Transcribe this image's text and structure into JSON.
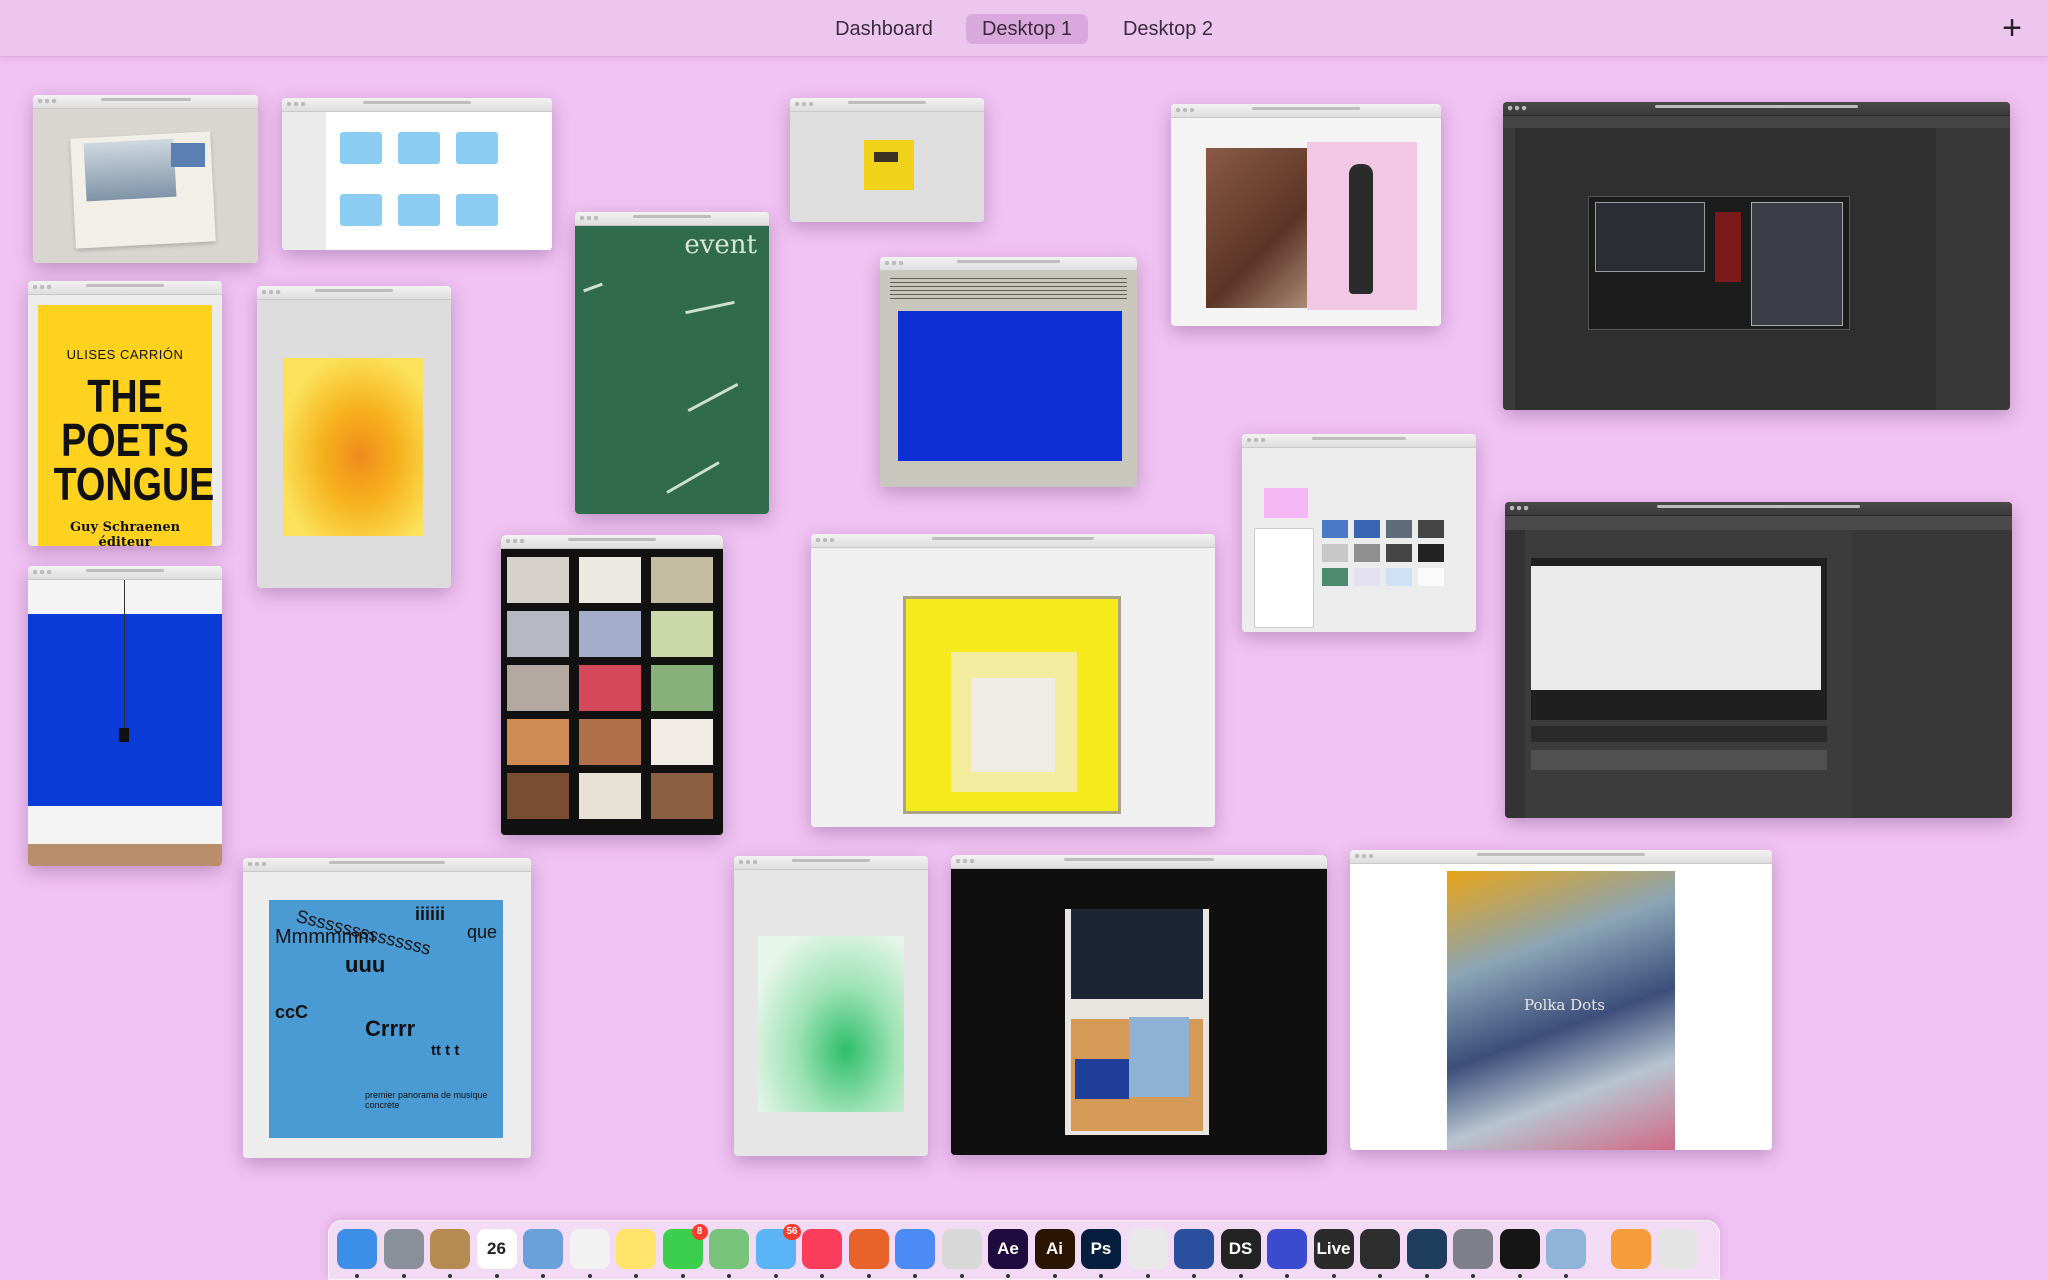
{
  "spaces": {
    "tabs": [
      {
        "label": "Dashboard",
        "active": false
      },
      {
        "label": "Desktop 1",
        "active": true
      },
      {
        "label": "Desktop 2",
        "active": false
      }
    ],
    "add_label": "+"
  },
  "windows": {
    "poets_tongue": {
      "author": "ULISES CARRIÓN",
      "title_line1": "THE",
      "title_line2": "POETS",
      "title_line3": "TONGUE",
      "publisher_line1": "Guy Schraenen",
      "publisher_line2": "éditeur"
    },
    "chalkboard": {
      "word": "event"
    },
    "concrete_music": {
      "line1": "Sssssssssssssss",
      "line2": "Mmmmmm",
      "line3": "uuu",
      "line4": "ccC",
      "line5": "Crrrr",
      "line6": "tt t t",
      "line7": "iiiiii",
      "line8": "que",
      "caption": "premier panorama de musique concrète"
    },
    "bags": {
      "caption": "Polka Dots"
    }
  },
  "dock": {
    "apps": [
      {
        "name": "finder-icon",
        "label": "",
        "color": "#3c8ee6"
      },
      {
        "name": "launchpad-icon",
        "label": "",
        "color": "#8a9099"
      },
      {
        "name": "contacts-icon",
        "label": "",
        "color": "#b78a52"
      },
      {
        "name": "calendar-icon",
        "label": "26",
        "color": "#ffffff"
      },
      {
        "name": "preview-icon",
        "label": "",
        "color": "#6aa0d8"
      },
      {
        "name": "photos-icon",
        "label": "",
        "color": "#f2f2f2"
      },
      {
        "name": "notes-icon",
        "label": "",
        "color": "#ffe36b"
      },
      {
        "name": "facetime-icon",
        "label": "",
        "color": "#3ccf4e",
        "badge": "8"
      },
      {
        "name": "maps-icon",
        "label": "",
        "color": "#79c27a"
      },
      {
        "name": "messages-icon",
        "label": "",
        "color": "#5ab4f5",
        "badge": "56"
      },
      {
        "name": "music-icon",
        "label": "",
        "color": "#fb3d5c"
      },
      {
        "name": "firefox-icon",
        "label": "",
        "color": "#e8632b"
      },
      {
        "name": "chrome-icon",
        "label": "",
        "color": "#4c8bf5"
      },
      {
        "name": "zbrush-icon",
        "label": "",
        "color": "#d8d8d8"
      },
      {
        "name": "after-effects-icon",
        "label": "Ae",
        "color": "#1f0b40"
      },
      {
        "name": "illustrator-icon",
        "label": "Ai",
        "color": "#2b1400"
      },
      {
        "name": "photoshop-icon",
        "label": "Ps",
        "color": "#061e3e"
      },
      {
        "name": "scrivener-icon",
        "label": "",
        "color": "#e9e9e9"
      },
      {
        "name": "cinema4d-icon",
        "label": "",
        "color": "#2a4f9e"
      },
      {
        "name": "dazstudio-icon",
        "label": "DS",
        "color": "#232323"
      },
      {
        "name": "coda-icon",
        "label": "",
        "color": "#3a4bd0"
      },
      {
        "name": "ableton-live-icon",
        "label": "Live",
        "color": "#2b2b2b"
      },
      {
        "name": "hive-icon",
        "label": "",
        "color": "#2d2d2d"
      },
      {
        "name": "hive-alt-icon",
        "label": "",
        "color": "#1f3d5c"
      },
      {
        "name": "system-preferences-icon",
        "label": "",
        "color": "#7d8088"
      },
      {
        "name": "serato-icon",
        "label": "",
        "color": "#151515"
      },
      {
        "name": "image-capture-icon",
        "label": "",
        "color": "#8fb3d9"
      },
      {
        "name": "folder-stack-icon",
        "label": "",
        "color": "#f59d3a"
      },
      {
        "name": "trash-icon",
        "label": "",
        "color": "#e4e4e4"
      }
    ]
  }
}
